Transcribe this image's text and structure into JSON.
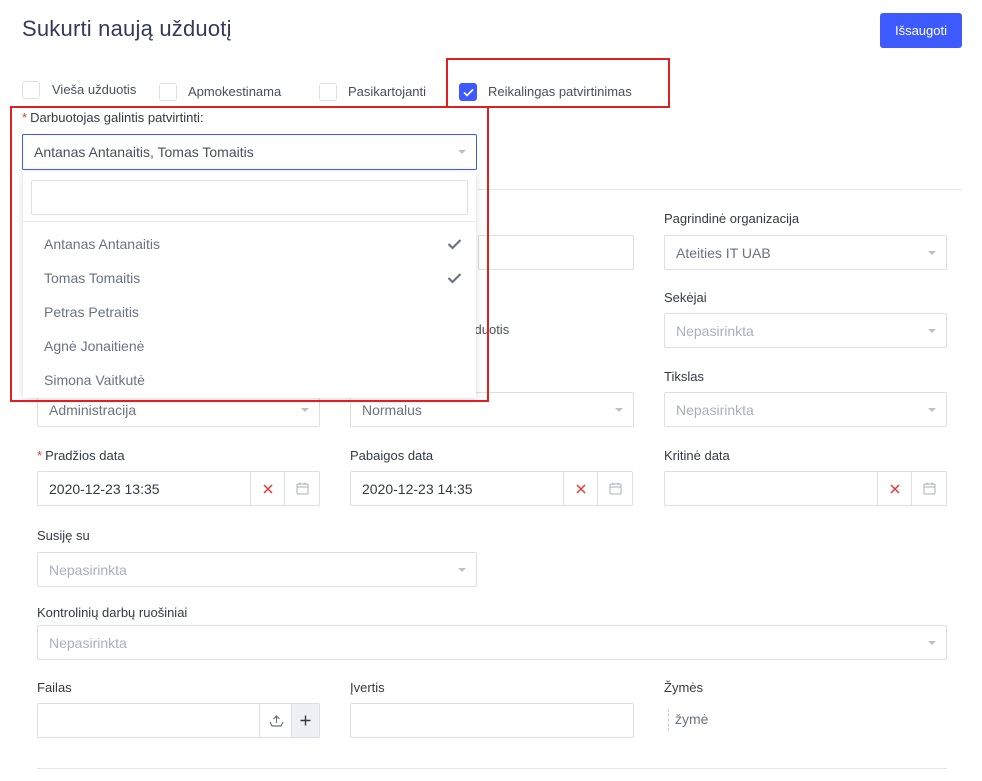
{
  "header": {
    "title": "Sukurti naują užduotį",
    "save_label": "Išsaugoti"
  },
  "checkboxes": [
    {
      "label": "Vieša užduotis",
      "checked": false
    },
    {
      "label": "Apmokestinama",
      "checked": false
    },
    {
      "label": "Pasikartojanti",
      "checked": false
    },
    {
      "label": "Reikalingas patvirtinimas",
      "checked": true
    }
  ],
  "approver": {
    "label": "Darbuotojas galintis patvirtinti:",
    "value": "Antanas Antanaitis, Tomas Tomaitis",
    "search_value": "",
    "options": [
      {
        "label": "Antanas Antanaitis",
        "selected": true
      },
      {
        "label": "Tomas Tomaitis",
        "selected": true
      },
      {
        "label": "Petras Petraitis",
        "selected": false
      },
      {
        "label": "Agnė Jonaitienė",
        "selected": false
      },
      {
        "label": "Simona Vaitkutė",
        "selected": false
      }
    ]
  },
  "partial_text": {
    "uzduotis_fragment": "zduotis"
  },
  "fields": {
    "main_org": {
      "label": "Pagrindinė organizacija",
      "value": "Ateities IT UAB"
    },
    "followers": {
      "label": "Sekėjai",
      "placeholder": "Nepasirinkta"
    },
    "category": {
      "value": "Administracija"
    },
    "priority": {
      "value": "Normalus"
    },
    "goal": {
      "label": "Tikslas",
      "placeholder": "Nepasirinkta"
    },
    "start_date": {
      "label": "Pradžios data",
      "value": "2020-12-23 13:35"
    },
    "end_date": {
      "label": "Pabaigos data",
      "value": "2020-12-23 14:35"
    },
    "critical_date": {
      "label": "Kritinė data",
      "value": ""
    },
    "related": {
      "label": "Susiję su",
      "placeholder": "Nepasirinkta"
    },
    "control_works": {
      "label": "Kontrolinių darbų ruošiniai",
      "placeholder": "Nepasirinkta"
    },
    "file": {
      "label": "Failas"
    },
    "estimate": {
      "label": "Įvertis",
      "value": ""
    },
    "tags": {
      "label": "Žymės",
      "placeholder": "žymė"
    }
  },
  "colors": {
    "accent": "#3d5afe",
    "highlight": "#e02020",
    "clear_icon": "#e53935"
  }
}
